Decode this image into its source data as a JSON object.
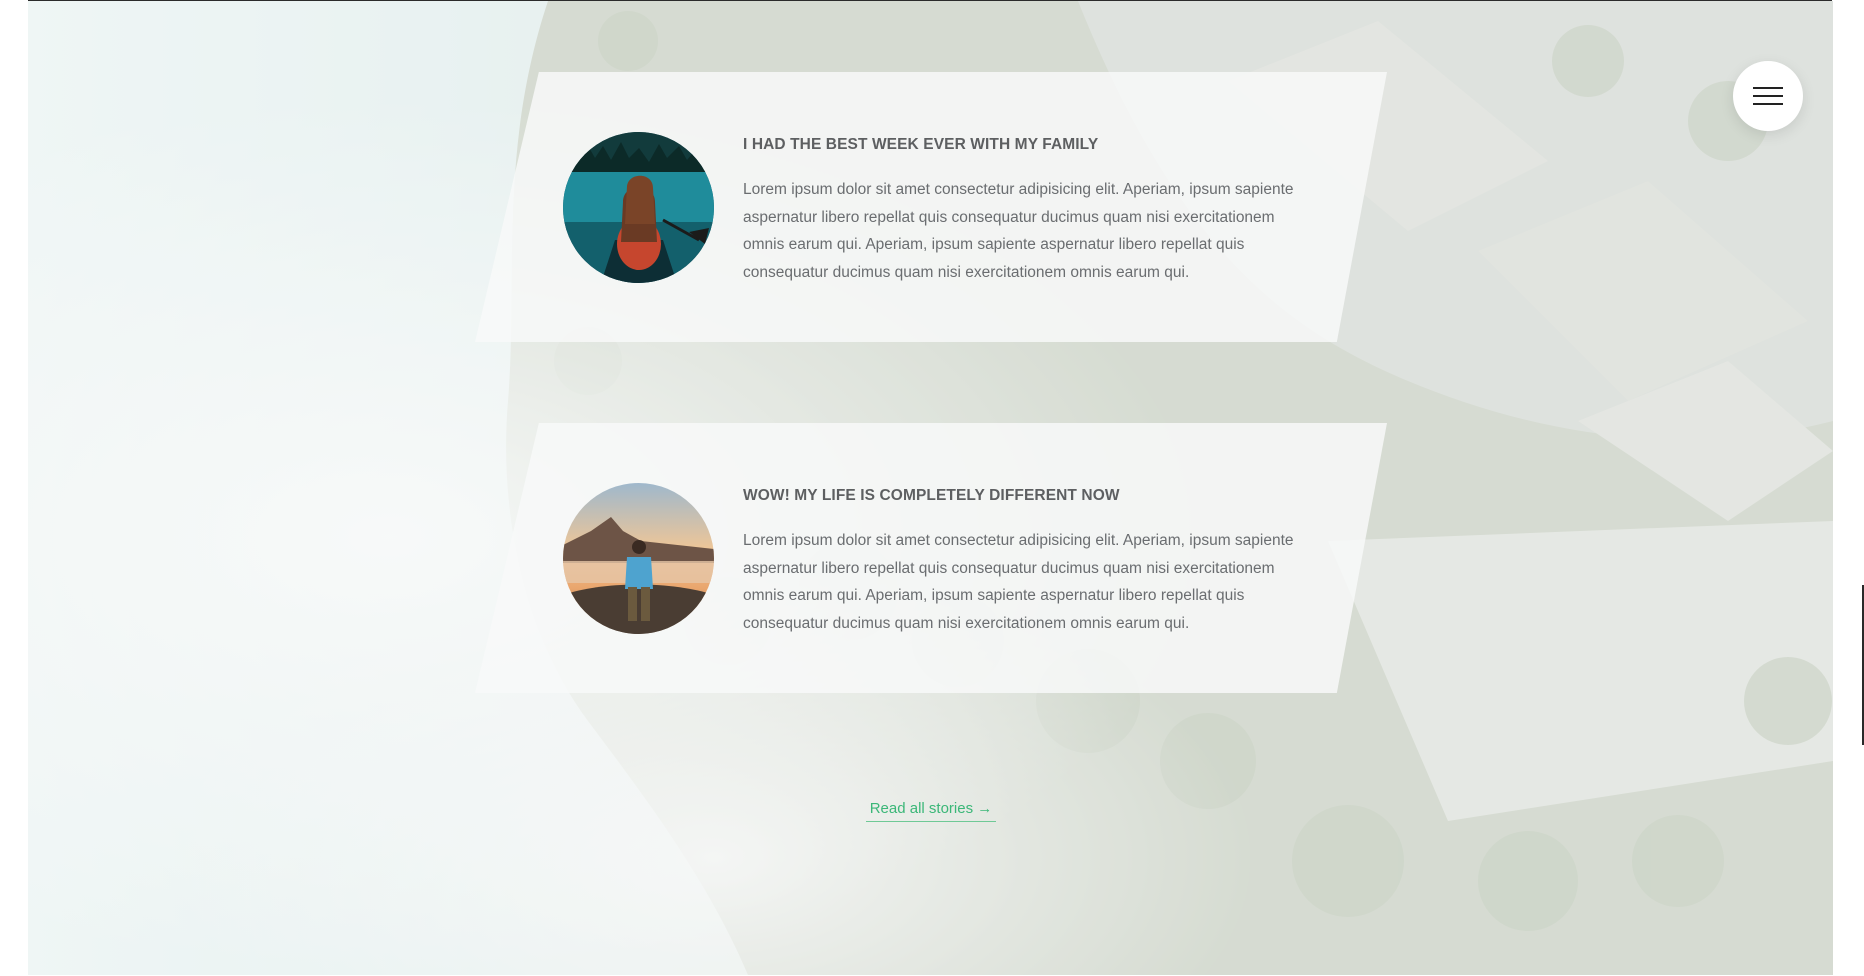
{
  "header": {
    "menu_button_icon": "hamburger-icon"
  },
  "stories": [
    {
      "title": "I HAD THE BEST WEEK EVER WITH MY FAMILY",
      "text": "Lorem ipsum dolor sit amet consectetur adipisicing elit. Aperiam, ipsum sapiente aspernatur libero repellat quis consequatur ducimus quam nisi exercitationem omnis earum qui. Aperiam, ipsum sapiente aspernatur libero repellat quis consequatur ducimus quam nisi exercitationem omnis earum qui.",
      "photo_icon": "woman-in-canoe-photo"
    },
    {
      "title": "WOW! MY LIFE IS COMPLETELY DIFFERENT NOW",
      "text": "Lorem ipsum dolor sit amet consectetur adipisicing elit. Aperiam, ipsum sapiente aspernatur libero repellat quis consequatur ducimus quam nisi exercitationem omnis earum qui. Aperiam, ipsum sapiente aspernatur libero repellat quis consequatur ducimus quam nisi exercitationem omnis earum qui.",
      "photo_icon": "man-on-mountain-photo"
    }
  ],
  "read_all_link": "Read all stories →",
  "colors": {
    "accent": "#3bb778",
    "heading": "#5d5f61",
    "body_text": "#6a6d70",
    "card_background": "#f8f9f9"
  }
}
